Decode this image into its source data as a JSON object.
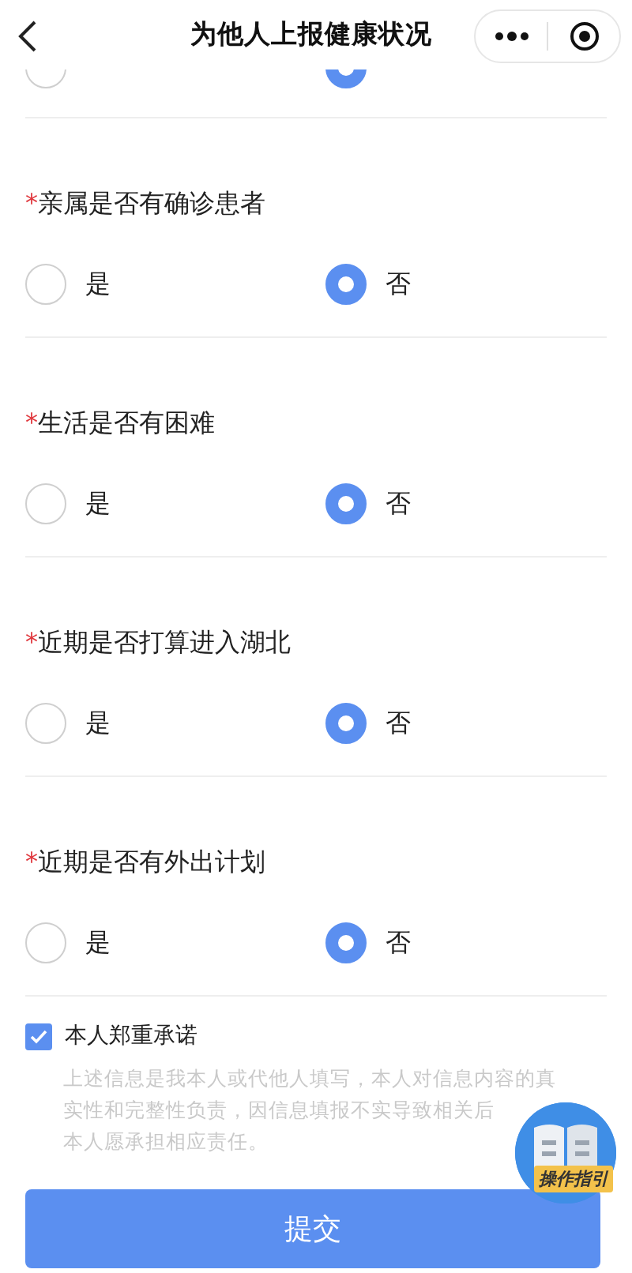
{
  "header": {
    "title": "为他人上报健康状况"
  },
  "previous_question": {
    "options": [
      {
        "selected": false
      },
      {
        "selected": true
      }
    ]
  },
  "questions": [
    {
      "label": "亲属是否有确诊患者",
      "required": true,
      "options": [
        {
          "label": "是",
          "selected": false
        },
        {
          "label": "否",
          "selected": true
        }
      ]
    },
    {
      "label": "生活是否有困难",
      "required": true,
      "options": [
        {
          "label": "是",
          "selected": false
        },
        {
          "label": "否",
          "selected": true
        }
      ]
    },
    {
      "label": "近期是否打算进入湖北",
      "required": true,
      "options": [
        {
          "label": "是",
          "selected": false
        },
        {
          "label": "否",
          "selected": true
        }
      ]
    },
    {
      "label": "近期是否有外出计划",
      "required": true,
      "options": [
        {
          "label": "是",
          "selected": false
        },
        {
          "label": "否",
          "selected": true
        }
      ]
    }
  ],
  "required_mark": "*",
  "pledge": {
    "label": "本人郑重承诺",
    "checked": true,
    "text_lines": [
      "上述信息是我本人或代他人填写，本人对信息内容的真",
      "实性和完整性负责，因信息填报不实导致相关后",
      "本人愿承担相应责任。"
    ]
  },
  "guide_badge": {
    "label": "操作指引"
  },
  "submit": {
    "label": "提交"
  }
}
